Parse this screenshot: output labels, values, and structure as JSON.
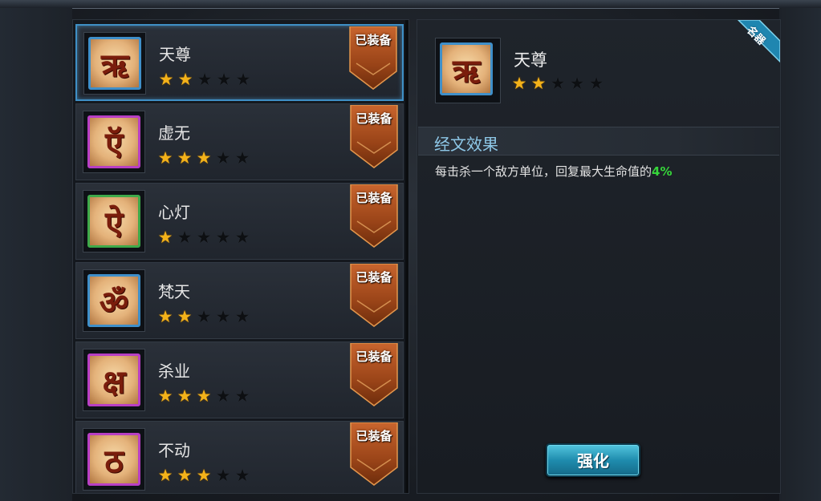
{
  "scriptures": {
    "items": [
      {
        "name": "天尊",
        "stars": 2,
        "max_stars": 5,
        "badge": "已装备",
        "glyph": "ऋ",
        "frame_color": "#3f8fc9",
        "selected": true
      },
      {
        "name": "虚无",
        "stars": 3,
        "max_stars": 5,
        "badge": "已装备",
        "glyph": "ऍ",
        "frame_color": "#b83fc4",
        "selected": false
      },
      {
        "name": "心灯",
        "stars": 1,
        "max_stars": 5,
        "badge": "已装备",
        "glyph": "ऐ",
        "frame_color": "#3ea94a",
        "selected": false
      },
      {
        "name": "梵天",
        "stars": 2,
        "max_stars": 5,
        "badge": "已装备",
        "glyph": "ॐ",
        "frame_color": "#3f8fc9",
        "selected": false
      },
      {
        "name": "杀业",
        "stars": 3,
        "max_stars": 5,
        "badge": "已装备",
        "glyph": "क्ष",
        "frame_color": "#b83fc4",
        "selected": false
      },
      {
        "name": "不动",
        "stars": 3,
        "max_stars": 5,
        "badge": "已装备",
        "glyph": "ठ",
        "frame_color": "#b83fc4",
        "selected": false
      }
    ]
  },
  "detail": {
    "name": "天尊",
    "stars": 2,
    "max_stars": 5,
    "glyph": "ऋ",
    "frame_color": "#3f8fc9",
    "corner_tag": "名器",
    "section_title": "经文效果",
    "description_prefix": "每击杀一个敌方单位，回复最大生命值的",
    "description_value": "4%",
    "strengthen_label": "强化"
  },
  "icons": {
    "star": "★"
  },
  "colors": {
    "star_on": "#f3b21a",
    "highlight_value": "#36d63a",
    "section_title": "#8ec8e8",
    "corner_tag": "#1f86b0",
    "badge_orange": "#b6562a",
    "selection_border": "#3f90c6"
  }
}
